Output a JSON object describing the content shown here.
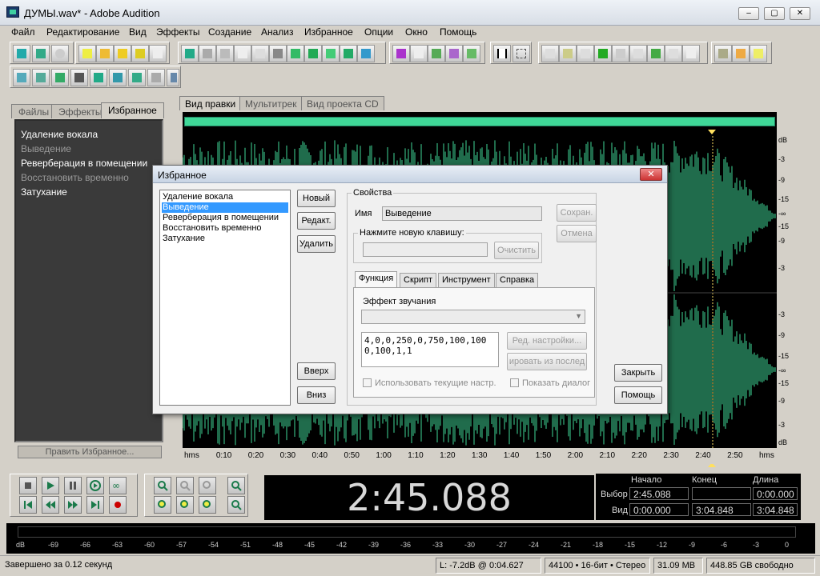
{
  "window": {
    "title": "ДУМЫ.wav* - Adobe Audition",
    "min": "–",
    "max": "▢",
    "close": "✕"
  },
  "menu": [
    "Файл",
    "Редактирование",
    "Вид",
    "Эффекты",
    "Создание",
    "Анализ",
    "Избранное",
    "Опции",
    "Окно",
    "Помощь"
  ],
  "left_panel": {
    "tabs": [
      "Файлы",
      "Эффекты",
      "Избранное"
    ],
    "items": [
      "Удаление вокала",
      "Выведение",
      "Реверберация в помещении",
      "Восстановить временно",
      "Затухание"
    ],
    "edit_button": "Править Избранное..."
  },
  "view_tabs": [
    "Вид правки",
    "Мультитрек",
    "Вид проекта CD"
  ],
  "time_ruler": [
    "hms",
    "0:10",
    "0:20",
    "0:30",
    "0:40",
    "0:50",
    "1:00",
    "1:10",
    "1:20",
    "1:30",
    "1:40",
    "1:50",
    "2:00",
    "2:10",
    "2:20",
    "2:30",
    "2:40",
    "2:50",
    "hms"
  ],
  "db_scale_top": [
    "dB",
    "-3",
    "-9",
    "-15",
    "-∞",
    "-15",
    "-9",
    "-3"
  ],
  "db_scale_bottom": [
    "-3",
    "-9",
    "-15",
    "-∞",
    "-15",
    "-9",
    "-3",
    "dB"
  ],
  "big_time": "2:45.088",
  "selection": {
    "headers": [
      "Начало",
      "Конец",
      "Длина"
    ],
    "rows": [
      {
        "label": "Выбор",
        "start": "2:45.088",
        "end": "",
        "length": "0:00.000"
      },
      {
        "label": "Вид",
        "start": "0:00.000",
        "end": "3:04.848",
        "length": "3:04.848"
      }
    ]
  },
  "level_scale": [
    "dB",
    "-69",
    "-66",
    "-63",
    "-60",
    "-57",
    "-54",
    "-51",
    "-48",
    "-45",
    "-42",
    "-39",
    "-36",
    "-33",
    "-30",
    "-27",
    "-24",
    "-21",
    "-18",
    "-15",
    "-12",
    "-9",
    "-6",
    "-3",
    "0"
  ],
  "status": {
    "message": "Завершено за 0.12 секунд",
    "level": "L: -7.2dB @",
    "level_time": "0:04.627",
    "format": "44100 • 16-бит • Стерео",
    "size": "31.09 MB",
    "free": "448.85 GB свободно"
  },
  "dialog": {
    "title": "Избранное",
    "close": "✕",
    "list": [
      "Удаление вокала",
      "Выведение",
      "Реверберация в помещении",
      "Восстановить временно",
      "Затухание"
    ],
    "selected_index": 1,
    "btn_new": "Новый",
    "btn_edit": "Редакт.",
    "btn_delete": "Удалить",
    "btn_up": "Вверх",
    "btn_down": "Вниз",
    "props_label": "Свойства",
    "name_label": "Имя",
    "name_value": "Выведение",
    "btn_save": "Сохран.",
    "btn_cancel": "Отмена",
    "hotkey_label": "Нажмите новую клавишу:",
    "hotkey_value": "",
    "btn_clear": "Очистить",
    "tabs": [
      "Функция",
      "Скрипт",
      "Инструмент",
      "Справка"
    ],
    "effect_label": "Эффект звучания",
    "effect_value": "",
    "params": "4,0,0,250,0,750,100,1000,100,1,1",
    "btn_edit_settings": "Ред. настройки...",
    "btn_copy_last": "ировать из послед",
    "chk_current": "Использовать текущие настр.",
    "chk_show": "Показать диалог",
    "btn_close": "Закрыть",
    "btn_help": "Помощь"
  }
}
